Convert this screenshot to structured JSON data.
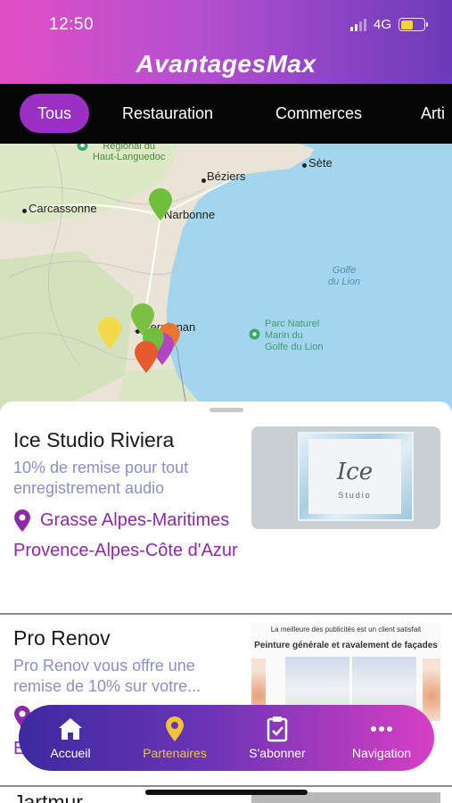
{
  "status_bar": {
    "time": "12:50",
    "network": "4G"
  },
  "app": {
    "title": "AvantagesMax"
  },
  "tabs": [
    {
      "label": "Tous",
      "active": true
    },
    {
      "label": "Restauration",
      "active": false
    },
    {
      "label": "Commerces",
      "active": false
    },
    {
      "label": "Arti",
      "active": false
    }
  ],
  "map": {
    "places": {
      "regional": "Régional du\nHaut-Languedoc",
      "beziers": "Béziers",
      "sete": "Sète",
      "carcassonne": "Carcassonne",
      "narbonne": "Narbonne",
      "perpignan": "Perpignan",
      "gulf": "Golfe\ndu Lion",
      "park": "Parc Naturel\nMarin du\nGolfe du Lion"
    },
    "pin_colors": [
      "#6fbf3f",
      "#f2d94a",
      "#7cc043",
      "#b046c4",
      "#e55b2d",
      "#e8762f"
    ]
  },
  "listings": [
    {
      "title": "Ice Studio Riviera",
      "description": "10% de remise pour tout enregistrement audio",
      "location": "Grasse Alpes-Maritimes Provence-Alpes-Côte d'Azur",
      "image": {
        "logo": "Ice",
        "subtitle": "Studio"
      }
    },
    {
      "title": "Pro Renov",
      "description": "Pro Renov vous offre une remise de 10% sur votre...",
      "location": "E",
      "image": {
        "line1": "La meilleure des publicités est un client satisfait",
        "line2": "Peinture générale et ravalement de façades"
      }
    },
    {
      "title": "Jartmur"
    }
  ],
  "bottom_nav": [
    {
      "label": "Accueil",
      "icon": "home-icon",
      "active": false
    },
    {
      "label": "Partenaires",
      "icon": "location-pin-icon",
      "active": true
    },
    {
      "label": "S'abonner",
      "icon": "clipboard-check-icon",
      "active": false
    },
    {
      "label": "Navigation",
      "icon": "more-dots-icon",
      "active": false
    }
  ],
  "colors": {
    "accent": "#9c2fc4",
    "active_nav": "#f0c23a",
    "location": "#8e2aa8",
    "description": "#8b8fc4",
    "sea": "#9fd3ee"
  }
}
